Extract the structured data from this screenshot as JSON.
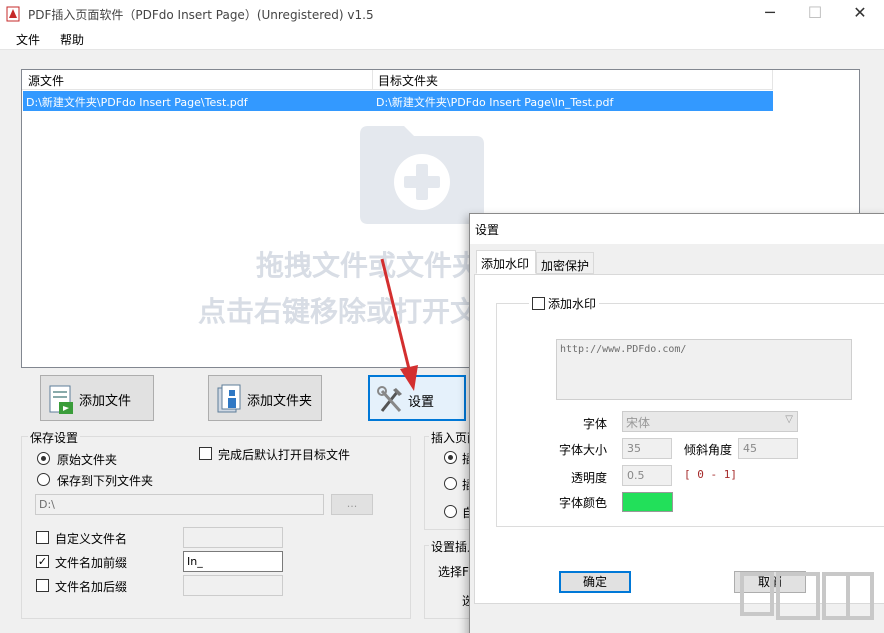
{
  "window": {
    "title": "PDF插入页面软件（PDFdo Insert Page）(Unregistered) v1.5",
    "minimize": "─",
    "maximize": "☐",
    "close": "✕"
  },
  "menu": {
    "file": "文件",
    "help": "帮助"
  },
  "file_list": {
    "columns": [
      "源文件",
      "目标文件夹"
    ],
    "rows": [
      {
        "source": "D:\\新建文件夹\\PDFdo Insert Page\\Test.pdf",
        "target": "D:\\新建文件夹\\PDFdo Insert Page\\In_Test.pdf",
        "selected": true
      }
    ],
    "hint_line1": "拖拽文件或文件夹到这里",
    "hint_line2": "点击右键移除或打开文件"
  },
  "toolbar": {
    "add_file": "添加文件",
    "add_folder": "添加文件夹",
    "settings": "设置"
  },
  "save_settings": {
    "title": "保存设置",
    "original_folder": "原始文件夹",
    "save_to_folder": "保存到下列文件夹",
    "open_after": "完成后默认打开目标文件",
    "folder_path": "D:\\",
    "browse": "...",
    "custom_name": "自定义文件名",
    "add_prefix": "文件名加前缀",
    "prefix_value": "In_",
    "add_suffix": "文件名加后缀"
  },
  "insert_group": {
    "title": "插入页面",
    "opt1": "插",
    "opt2": "插",
    "opt3": "自"
  },
  "insert_settings": {
    "title": "设置插入",
    "select_label": "选择F",
    "third_label": "选"
  },
  "dialog": {
    "title": "设置",
    "close": "✕",
    "tabs": [
      "添加水印",
      "加密保护"
    ],
    "add_watermark": "添加水印",
    "watermark_text": "http://www.PDFdo.com/",
    "font_label": "字体",
    "font_value": "宋体",
    "font_size_label": "字体大小",
    "font_size_value": "35",
    "tilt_label": "倾斜角度",
    "tilt_value": "45",
    "opacity_label": "透明度",
    "opacity_value": "0.5",
    "opacity_range": "[ 0 - 1]",
    "font_color_label": "字体颜色",
    "font_color": "#22e05a",
    "ok": "确定",
    "cancel": "取消"
  },
  "colors": {
    "selection": "#3399ff",
    "arrow": "#d32f2f",
    "accent": "#0078d7"
  }
}
